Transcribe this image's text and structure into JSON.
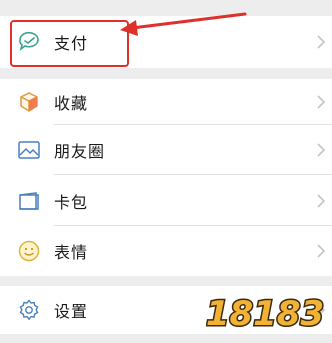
{
  "menu": {
    "items": [
      {
        "label": "支付",
        "icon": "wallet-icon"
      },
      {
        "label": "收藏",
        "icon": "cube-icon"
      },
      {
        "label": "朋友圈",
        "icon": "image-icon"
      },
      {
        "label": "卡包",
        "icon": "card-icon"
      },
      {
        "label": "表情",
        "icon": "emoji-icon"
      },
      {
        "label": "设置",
        "icon": "gear-icon"
      }
    ]
  },
  "annotation": {
    "color": "#e0302b"
  },
  "watermark": {
    "text": "18183"
  }
}
